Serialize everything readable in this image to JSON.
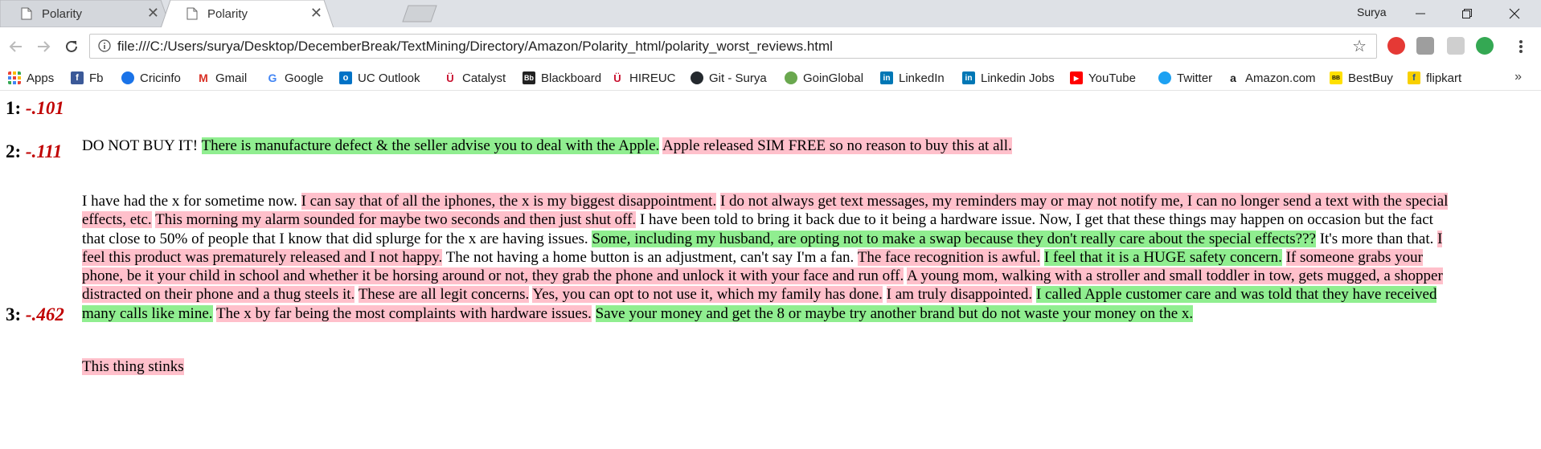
{
  "tabs": [
    {
      "title": "Polarity",
      "active": false
    },
    {
      "title": "Polarity",
      "active": true
    }
  ],
  "window": {
    "profile": "Surya"
  },
  "address_bar": {
    "url": "file:///C:/Users/surya/Desktop/DecemberBreak/TextMining/Directory/Amazon/Polarity_html/polarity_worst_reviews.html"
  },
  "bookmarks": [
    {
      "label": "Apps",
      "icon": "apps-grid-icon"
    },
    {
      "label": "Fb",
      "icon": "facebook-icon",
      "color": "#3b5998"
    },
    {
      "label": "Cricinfo",
      "icon": "cricinfo-icon",
      "color": "#1a73e8"
    },
    {
      "label": "Gmail",
      "icon": "gmail-icon",
      "color": "#d93025"
    },
    {
      "label": "Google",
      "icon": "google-icon",
      "color": "#4285f4"
    },
    {
      "label": "UC Outlook",
      "icon": "outlook-icon",
      "color": "#0072c6"
    },
    {
      "label": "Catalyst",
      "icon": "uc-icon",
      "color": "#c8102e"
    },
    {
      "label": "Blackboard",
      "icon": "blackboard-icon",
      "color": "#222222"
    },
    {
      "label": "HIREUC",
      "icon": "uc-icon",
      "color": "#c8102e"
    },
    {
      "label": "Git - Surya",
      "icon": "github-icon",
      "color": "#24292e"
    },
    {
      "label": "GoinGlobal",
      "icon": "goinglobal-icon",
      "color": "#6aa84f"
    },
    {
      "label": "LinkedIn",
      "icon": "linkedin-icon",
      "color": "#0077b5"
    },
    {
      "label": "Linkedin Jobs",
      "icon": "linkedin-icon",
      "color": "#0077b5"
    },
    {
      "label": "YouTube",
      "icon": "youtube-icon",
      "color": "#ff0000"
    },
    {
      "label": "Twitter",
      "icon": "twitter-icon",
      "color": "#1da1f2"
    },
    {
      "label": "Amazon.com",
      "icon": "amazon-icon",
      "color": "#222222"
    },
    {
      "label": "BestBuy",
      "icon": "bestbuy-icon",
      "color": "#ffe000"
    },
    {
      "label": "flipkart",
      "icon": "flipkart-icon",
      "color": "#f8d000"
    }
  ],
  "reviews": [
    {
      "rank": "1:",
      "score": "-.101",
      "sentences": [
        {
          "text": "DO NOT BUY IT!",
          "polarity": "neutral"
        },
        {
          "text": "There is manufacture defect & the seller advise you to deal with the Apple.",
          "polarity": "positive"
        },
        {
          "text": "Apple released SIM FREE so no reason to buy this at all.",
          "polarity": "negative"
        }
      ]
    },
    {
      "rank": "2:",
      "score": "-.111",
      "sentences": [
        {
          "text": "I have had the x for sometime now.",
          "polarity": "neutral"
        },
        {
          "text": "I can say that of all the iphones, the x is my biggest disappointment.",
          "polarity": "negative"
        },
        {
          "text": "I do not always get text messages, my reminders may or may not notify me, I can no longer send a text with the special effects, etc.",
          "polarity": "negative"
        },
        {
          "text": "This morning my alarm sounded for maybe two seconds and then just shut off.",
          "polarity": "negative"
        },
        {
          "text": "I have been told to bring it back due to it being a hardware issue. Now, I get that these things may happen on occasion but the fact that close to 50% of people that I know that did splurge for the x are having issues.",
          "polarity": "neutral"
        },
        {
          "text": "Some, including my husband, are opting not to make a swap because they don't really care about the special effects???",
          "polarity": "positive"
        },
        {
          "text": "It's more than that.",
          "polarity": "neutral"
        },
        {
          "text": "I feel this product was prematurely released and I not happy.",
          "polarity": "negative"
        },
        {
          "text": "The not having a home button is an adjustment, can't say I'm a fan.",
          "polarity": "neutral"
        },
        {
          "text": "The face recognition is awful.",
          "polarity": "negative"
        },
        {
          "text": "I feel that it is a HUGE safety concern.",
          "polarity": "positive"
        },
        {
          "text": "If someone grabs your phone, be it your child in school and whether it be horsing around or not, they grab the phone and unlock it with your face and run off.",
          "polarity": "negative"
        },
        {
          "text": "A young mom, walking with a stroller and small toddler in tow, gets mugged, a shopper distracted on their phone and a thug steels it.",
          "polarity": "negative"
        },
        {
          "text": "These are all legit concerns.",
          "polarity": "negative"
        },
        {
          "text": "Yes, you can opt to not use it, which my family has done.",
          "polarity": "negative"
        },
        {
          "text": "I am truly disappointed.",
          "polarity": "negative"
        },
        {
          "text": "I called Apple customer care and was told that they have received many calls like mine.",
          "polarity": "positive"
        },
        {
          "text": "The x by far being the most complaints with hardware issues.",
          "polarity": "negative"
        },
        {
          "text": "Save your money and get the 8 or maybe try another brand but do not waste your money on the x.",
          "polarity": "positive"
        }
      ]
    },
    {
      "rank": "3:",
      "score": "-.462",
      "sentences": [
        {
          "text": "This thing stinks",
          "polarity": "negative"
        }
      ]
    }
  ],
  "colors": {
    "positive": "#90ee90",
    "negative": "#ffc0cb",
    "score": "#c00000"
  }
}
